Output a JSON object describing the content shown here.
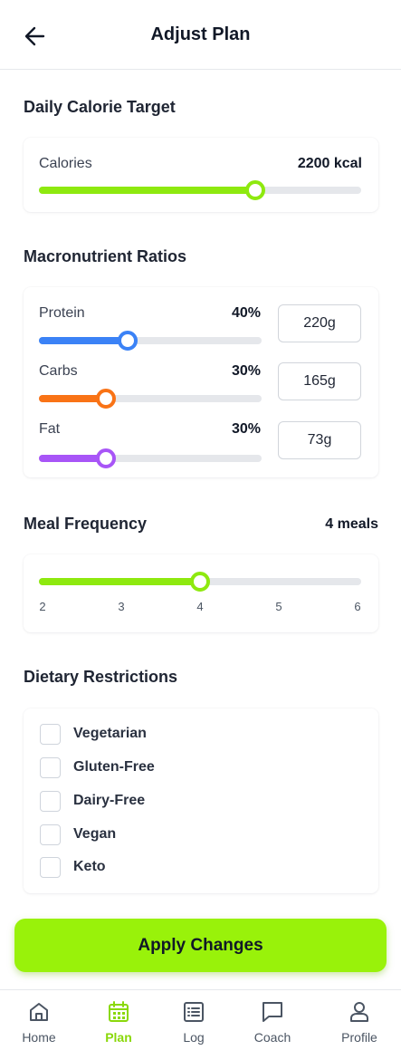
{
  "header": {
    "title": "Adjust Plan"
  },
  "calorie": {
    "section_title": "Daily Calorie Target",
    "label": "Calories",
    "value": "2200 kcal",
    "fill_fraction": 0.67,
    "color": "#8ee90f"
  },
  "macros": {
    "section_title": "Macronutrient Ratios",
    "items": [
      {
        "label": "Protein",
        "percent": "40%",
        "grams": "220g",
        "fill_fraction": 0.4,
        "color": "#3b82f6"
      },
      {
        "label": "Carbs",
        "percent": "30%",
        "grams": "165g",
        "fill_fraction": 0.3,
        "color": "#f97316"
      },
      {
        "label": "Fat",
        "percent": "30%",
        "grams": "73g",
        "fill_fraction": 0.3,
        "color": "#a855f7"
      }
    ]
  },
  "meals": {
    "section_title": "Meal Frequency",
    "value": "4 meals",
    "ticks": [
      "2",
      "3",
      "4",
      "5",
      "6"
    ],
    "selected": 4,
    "min": 2,
    "max": 6,
    "color": "#8ee90f"
  },
  "diet": {
    "section_title": "Dietary Restrictions",
    "options": [
      "Vegetarian",
      "Gluten-Free",
      "Dairy-Free",
      "Vegan",
      "Keto"
    ]
  },
  "apply_label": "Apply Changes",
  "nav": {
    "items": [
      {
        "label": "Home",
        "icon": "home-icon"
      },
      {
        "label": "Plan",
        "icon": "calendar-icon",
        "active": true
      },
      {
        "label": "Log",
        "icon": "list-icon"
      },
      {
        "label": "Coach",
        "icon": "chat-icon"
      },
      {
        "label": "Profile",
        "icon": "user-icon"
      }
    ],
    "active_color": "#8ad80a"
  }
}
